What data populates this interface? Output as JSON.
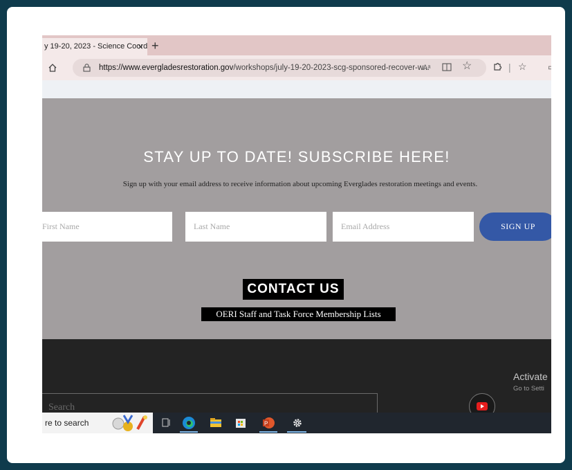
{
  "browser": {
    "tab_title": "y 19-20, 2023 - Science Coord",
    "tab_close": "×",
    "new_tab": "+",
    "url_host": "https://www.evergladesrestoration.gov",
    "url_path": "/workshops/july-19-20-2023-scg-sponsored-recover-w...",
    "read_aloud": "Aᵃ",
    "toolbar_icons": [
      "home-icon",
      "lock-icon",
      "read-aloud-icon",
      "immersive-reader-icon",
      "favorite-star-icon",
      "extensions-icon",
      "favorites-icon"
    ]
  },
  "subscribe": {
    "title": "STAY UP TO DATE! SUBSCRIBE HERE!",
    "description": "Sign up with your email address to receive information about upcoming Everglades restoration meetings and events.",
    "first_name_placeholder": "First Name",
    "last_name_placeholder": "Last Name",
    "email_placeholder": "Email Address",
    "signup_label": "SIGN UP"
  },
  "contact": {
    "title": "CONTACT US",
    "link": "OERI Staff and Task Force Membership Lists"
  },
  "footer": {
    "search_placeholder": "Search",
    "activate_title": "Activate",
    "activate_sub": "Go to Setti"
  },
  "taskbar": {
    "search_text": "re to search"
  },
  "colors": {
    "subscribe_bg": "#a29e9f",
    "signup_button": "#3458a6",
    "footer_bg": "#232323",
    "tab_bar": "#e2c6c6"
  }
}
